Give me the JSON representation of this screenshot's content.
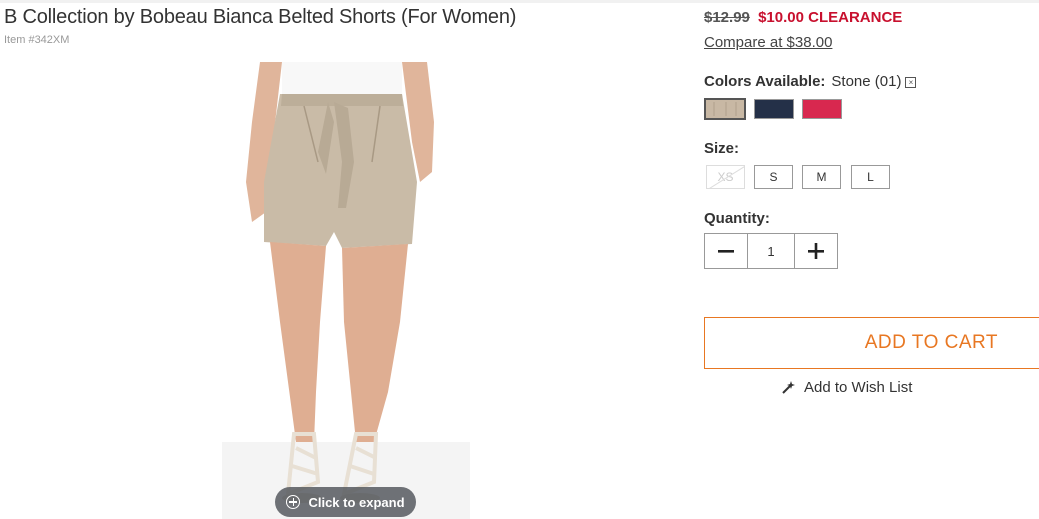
{
  "product": {
    "title": "B Collection by Bobeau Bianca Belted Shorts (For Women)",
    "item_number": "Item #342XM",
    "expand_label": "Click to expand"
  },
  "pricing": {
    "original": "$12.99",
    "current": "$10.00 CLEARANCE",
    "compare": "Compare at $38.00",
    "accent_color": "#c8102e"
  },
  "colors": {
    "label": "Colors Available:",
    "selected": "Stone (01)",
    "clear_icon": "x-box-icon",
    "swatches": [
      {
        "name": "stone",
        "hex": "#c8b8a4",
        "selected": true
      },
      {
        "name": "navy",
        "hex": "#243048",
        "selected": false
      },
      {
        "name": "red",
        "hex": "#d8284f",
        "selected": false
      }
    ]
  },
  "size": {
    "label": "Size:",
    "options": [
      {
        "label": "XS",
        "available": false
      },
      {
        "label": "S",
        "available": true
      },
      {
        "label": "M",
        "available": true
      },
      {
        "label": "L",
        "available": true
      }
    ]
  },
  "quantity": {
    "label": "Quantity:",
    "value": "1",
    "minus_icon": "minus-icon",
    "plus_icon": "plus-icon"
  },
  "cart": {
    "add_label": "ADD TO CART",
    "wish_label": "Add to Wish List",
    "wish_icon": "wand-icon",
    "accent_color": "#e87722"
  }
}
